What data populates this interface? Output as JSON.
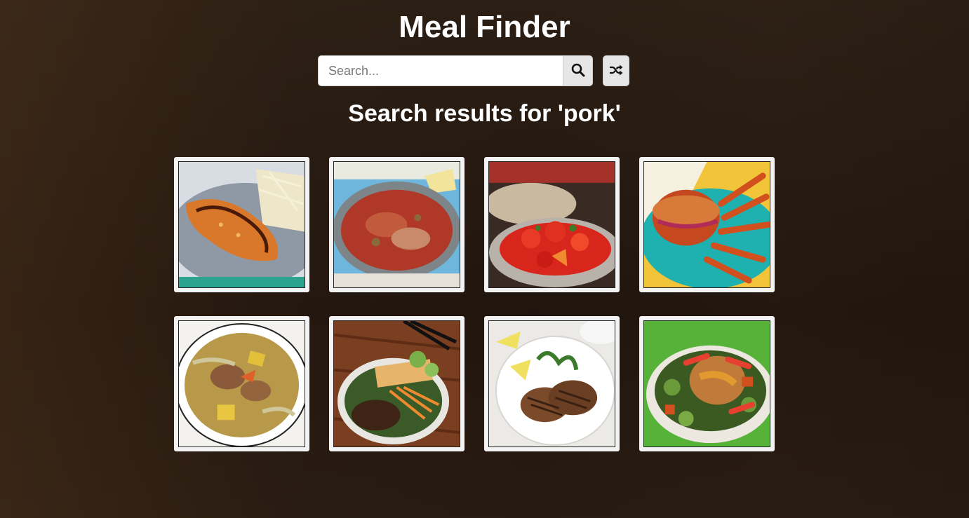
{
  "app": {
    "title": "Meal Finder"
  },
  "search": {
    "placeholder": "Search...",
    "value": ""
  },
  "icons": {
    "search": "search-icon",
    "random": "shuffle-icon"
  },
  "results": {
    "heading": "Search results for 'pork'"
  },
  "meals": [
    {
      "icon": "pork-katsu-image"
    },
    {
      "icon": "pork-stew-pan-image"
    },
    {
      "icon": "sweet-and-sour-pork-image"
    },
    {
      "icon": "pulled-pork-sandwich-image"
    },
    {
      "icon": "pork-cabbage-soup-image"
    },
    {
      "icon": "vietnamese-pork-bowl-image"
    },
    {
      "icon": "grilled-pork-chops-image"
    },
    {
      "icon": "pork-chops-apples-image"
    }
  ]
}
